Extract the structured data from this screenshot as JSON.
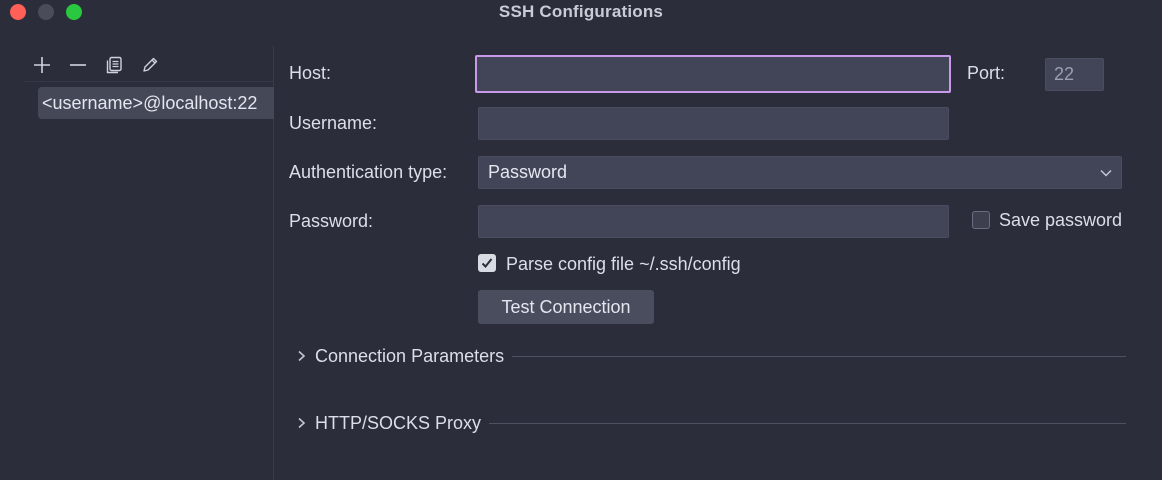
{
  "window": {
    "title": "SSH Configurations",
    "controls": [
      "close",
      "minimize",
      "maximize"
    ]
  },
  "sidebar": {
    "toolbar": [
      {
        "icon": "plus-icon"
      },
      {
        "icon": "minus-icon"
      },
      {
        "icon": "copy-icon"
      },
      {
        "icon": "edit-icon"
      }
    ],
    "items": [
      {
        "label": "<username>@localhost:22",
        "selected": true
      }
    ]
  },
  "form": {
    "host": {
      "label": "Host:",
      "value": ""
    },
    "port": {
      "label": "Port:",
      "value": "22"
    },
    "username": {
      "label": "Username:",
      "value": ""
    },
    "auth_type": {
      "label": "Authentication type:",
      "value": "Password"
    },
    "password": {
      "label": "Password:",
      "value": ""
    },
    "save_password": {
      "label": "Save password",
      "checked": false
    },
    "parse_config": {
      "label": "Parse config file ~/.ssh/config",
      "checked": true
    },
    "test_button": "Test Connection"
  },
  "sections": [
    {
      "title": "Connection Parameters",
      "expanded": false
    },
    {
      "title": "HTTP/SOCKS Proxy",
      "expanded": false
    }
  ],
  "colors": {
    "background": "#2b2d3a",
    "field": "#424557",
    "focus_border": "#c99ae9",
    "selected_item": "#454857"
  }
}
